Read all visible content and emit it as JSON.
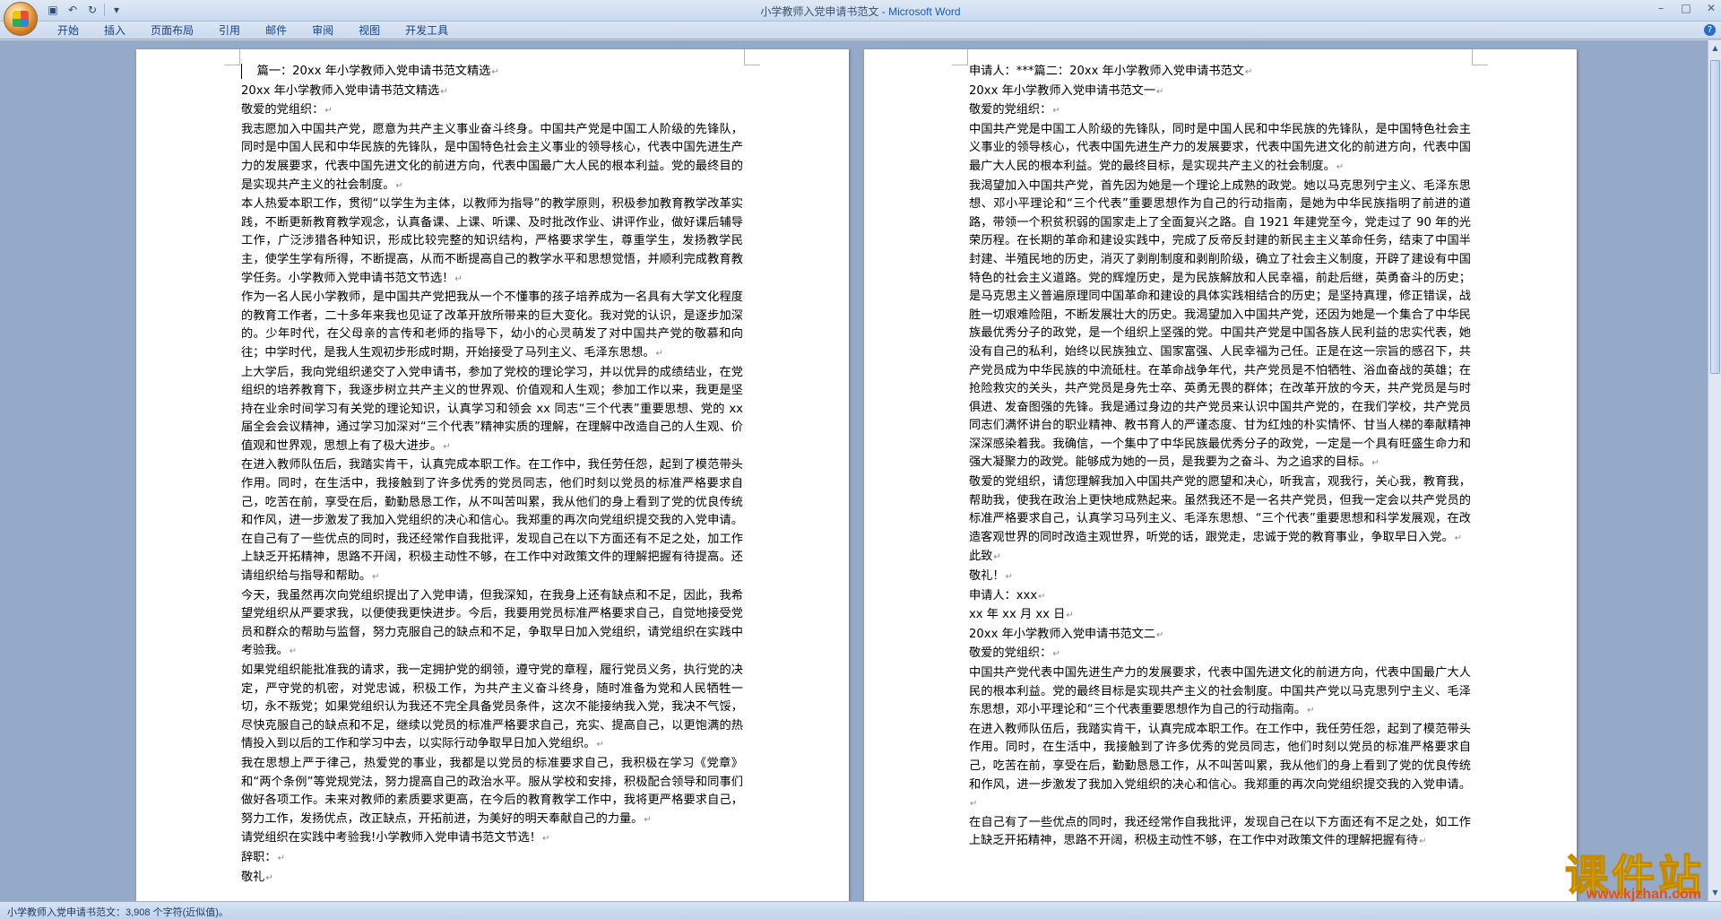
{
  "window": {
    "doc_title": "小学教师入党申请书范文",
    "separator": " - ",
    "app_name": "Microsoft Word"
  },
  "quick_access": {
    "icons": [
      "save-icon",
      "undo-icon",
      "redo-icon",
      "customize-icon"
    ]
  },
  "ribbon": {
    "tabs": [
      "开始",
      "插入",
      "页面布局",
      "引用",
      "邮件",
      "审阅",
      "视图",
      "开发工具"
    ]
  },
  "left_page": {
    "paragraphs": [
      "篇一：20xx 年小学教师入党申请书范文精选",
      "20xx 年小学教师入党申请书范文精选",
      "敬爱的党组织：",
      "我志愿加入中国共产党，愿意为共产主义事业奋斗终身。中国共产党是中国工人阶级的先锋队，同时是中国人民和中华民族的先锋队，是中国特色社会主义事业的领导核心，代表中国先进生产力的发展要求，代表中国先进文化的前进方向，代表中国最广大人民的根本利益。党的最终目的是实现共产主义的社会制度。",
      "本人热爱本职工作，贯彻“以学生为主体，以教师为指导”的教学原则，积极参加教育教学改革实践，不断更新教育教学观念，认真备课、上课、听课、及时批改作业、讲评作业，做好课后辅导工作，广泛涉猎各种知识，形成比较完整的知识结构，严格要求学生，尊重学生，发扬教学民主，使学生学有所得，不断提高，从而不断提高自己的教学水平和思想觉悟，并顺利完成教育教学任务。小学教师入党申请书范文节选！",
      "作为一名人民小学教师，是中国共产党把我从一个不懂事的孩子培养成为一名具有大学文化程度的教育工作者，二十多年来我也见证了改革开放所带来的巨大变化。我对党的认识，是逐步加深的。少年时代，在父母亲的言传和老师的指导下，幼小的心灵萌发了对中国共产党的敬慕和向往；中学时代，是我人生观初步形成时期，开始接受了马列主义、毛泽东思想。",
      "上大学后，我向党组织递交了入党申请书，参加了党校的理论学习，并以优异的成绩结业，在党组织的培养教育下，我逐步树立共产主义的世界观、价值观和人生观；参加工作以来，我更是坚持在业余时间学习有关党的理论知识，认真学习和领会 xx 同志“三个代表”重要思想、党的 xx 届全会会议精神，通过学习加深对“三个代表”精神实质的理解，在理解中改造自己的人生观、价值观和世界观，思想上有了极大进步。",
      "在进入教师队伍后，我踏实肯干，认真完成本职工作。在工作中，我任劳任怨，起到了模范带头作用。同时，在生活中，我接触到了许多优秀的党员同志，他们时刻以党员的标准严格要求自己，吃苦在前，享受在后，勤勤恳恳工作，从不叫苦叫累，我从他们的身上看到了党的优良传统和作风，进一步激发了我加入党组织的决心和信心。我郑重的再次向党组织提交我的入党申请。在自己有了一些优点的同时，我还经常作自我批评，发现自己在以下方面还有不足之处，加工作上缺乏开拓精神，思路不开阔，积极主动性不够，在工作中对政策文件的理解把握有待提高。还请组织给与指导和帮助。",
      "今天，我虽然再次向党组织提出了入党申请，但我深知，在我身上还有缺点和不足，因此，我希望党组织从严要求我，以便使我更快进步。今后，我要用党员标准严格要求自己，自觉地接受党员和群众的帮助与监督，努力克服自己的缺点和不足，争取早日加入党组织，请党组织在实践中考验我。",
      "如果党组织能批准我的请求，我一定拥护党的纲领，遵守党的章程，履行党员义务，执行党的决定，严守党的机密，对党忠诚，积极工作，为共产主义奋斗终身，随时准备为党和人民牺牲一切，永不叛党；如果党组织认为我还不完全具备党员条件，这次不能接纳我入党，我决不气馁，尽快克服自己的缺点和不足，继续以党员的标准严格要求自己，充实、提高自己，以更饱满的热情投入到以后的工作和学习中去，以实际行动争取早日加入党组织。",
      "我在思想上严于律己，热爱党的事业，我都是以党员的标准要求自己，我积极在学习《党章》和“两个条例”等党规党法，努力提高自己的政治水平。服从学校和安排，积极配合领导和同事们做好各项工作。未来对教师的素质要求更高，在今后的教育教学工作中，我将更严格要求自己，努力工作，发扬优点，改正缺点，开拓前进，为美好的明天奉献自己的力量。",
      "请党组织在实践中考验我!小学教师入党申请书范文节选！",
      "辞职：",
      "敬礼"
    ]
  },
  "right_page": {
    "paragraphs": [
      "申请人：***篇二：20xx 年小学教师入党申请书范文",
      "20xx 年小学教师入党申请书范文一",
      "敬爱的党组织：",
      "中国共产党是中国工人阶级的先锋队，同时是中国人民和中华民族的先锋队，是中国特色社会主义事业的领导核心，代表中国先进生产力的发展要求，代表中国先进文化的前进方向，代表中国最广大人民的根本利益。党的最终目标，是实现共产主义的社会制度。",
      "我渴望加入中国共产党，首先因为她是一个理论上成熟的政党。她以马克思列宁主义、毛泽东思想、邓小平理论和“三个代表”重要思想作为自己的行动指南，是她为中华民族指明了前进的道路，带领一个积贫积弱的国家走上了全面复兴之路。自 1921 年建党至今，党走过了 90 年的光荣历程。在长期的革命和建设实践中，完成了反帝反封建的新民主主义革命任务，结束了中国半封建、半殖民地的历史，消灭了剥削制度和剥削阶级，确立了社会主义制度，开辟了建设有中国特色的社会主义道路。党的辉煌历史，是为民族解放和人民幸福，前赴后继，英勇奋斗的历史；是马克思主义普遍原理同中国革命和建设的具体实践相结合的历史；是坚持真理，修正错误，战胜一切艰难险阻，不断发展壮大的历史。我渴望加入中国共产党，还因为她是一个集合了中华民族最优秀分子的政党，是一个组织上坚强的党。中国共产党是中国各族人民利益的忠实代表，她没有自己的私利，始终以民族独立、国家富强、人民幸福为己任。正是在这一宗旨的感召下，共产党员成为中华民族的中流砥柱。在革命战争年代，共产党员是不怕牺牲、浴血奋战的英雄；在抢险救灾的关头，共产党员是身先士卒、英勇无畏的群体；在改革开放的今天，共产党员是与时俱进、发奋图强的先锋。我是通过身边的共产党员来认识中国共产党的，在我们学校，共产党员同志们满怀讲台的职业精神、教书育人的严谨态度、甘为红烛的朴实情怀、甘当人梯的奉献精神深深感染着我。我确信，一个集中了中华民族最优秀分子的政党，一定是一个具有旺盛生命力和强大凝聚力的政党。能够成为她的一员，是我要为之奋斗、为之追求的目标。",
      "敬爱的党组织，请您理解我加入中国共产党的愿望和决心，听我言，观我行，关心我，教育我，帮助我，使我在政治上更快地成熟起来。虽然我还不是一名共产党员，但我一定会以共产党员的标准严格要求自己，认真学习马列主义、毛泽东思想、“三个代表”重要思想和科学发展观，在改造客观世界的同时改造主观世界，听党的话，跟党走，忠诚于党的教育事业，争取早日入党。",
      "此致",
      "敬礼！",
      "申请人：xxx",
      "xx 年 xx 月 xx 日",
      "20xx 年小学教师入党申请书范文二",
      "敬爱的党组织：",
      "中国共产党代表中国先进生产力的发展要求，代表中国先进文化的前进方向，代表中国最广大人民的根本利益。党的最终目标是实现共产主义的社会制度。中国共产党以马克思列宁主义、毛泽东思想，邓小平理论和“三个代表重要思想作为自己的行动指南。",
      "在进入教师队伍后，我踏实肯干，认真完成本职工作。在工作中，我任劳任怨，起到了模范带头作用。同时，在生活中，我接触到了许多优秀的党员同志，他们时刻以党员的标准严格要求自己，吃苦在前，享受在后，勤勤恳恳工作，从不叫苦叫累，我从他们的身上看到了党的优良传统和作风，进一步激发了我加入党组织的决心和信心。我郑重的再次向党组织提交我的入党申请。",
      "在自己有了一些优点的同时，我还经常作自我批评，发现自己在以下方面还有不足之处，如工作上缺乏开拓精神，思路不开阔，积极主动性不够，在工作中对政策文件的理解把握有待"
    ]
  },
  "status_bar": {
    "text": "小学教师入党申请书范文：3,908 个字符(近似值)。"
  },
  "watermark": {
    "logo_text": "课件站",
    "url": "www.kjzhan.com"
  }
}
